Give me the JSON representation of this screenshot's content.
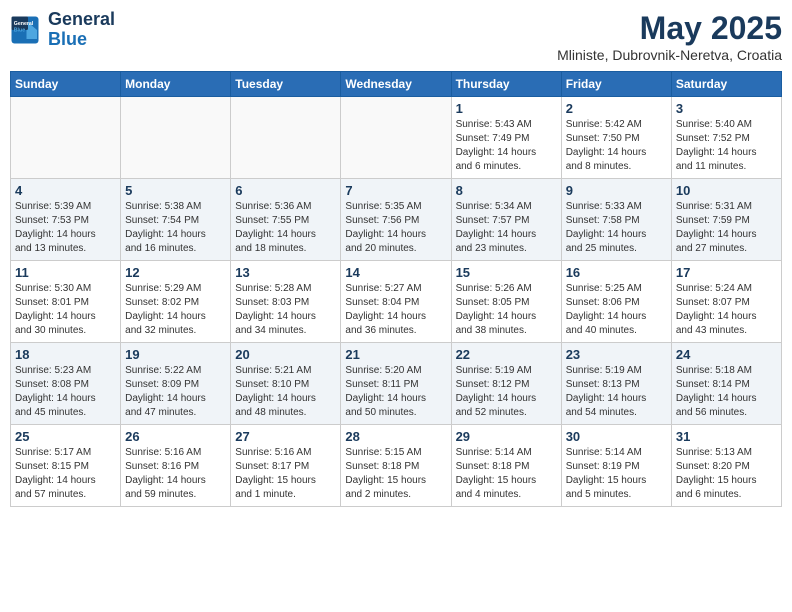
{
  "header": {
    "logo_line1": "General",
    "logo_line2": "Blue",
    "month": "May 2025",
    "location": "Mliniste, Dubrovnik-Neretva, Croatia"
  },
  "weekdays": [
    "Sunday",
    "Monday",
    "Tuesday",
    "Wednesday",
    "Thursday",
    "Friday",
    "Saturday"
  ],
  "weeks": [
    [
      {
        "day": "",
        "info": ""
      },
      {
        "day": "",
        "info": ""
      },
      {
        "day": "",
        "info": ""
      },
      {
        "day": "",
        "info": ""
      },
      {
        "day": "1",
        "info": "Sunrise: 5:43 AM\nSunset: 7:49 PM\nDaylight: 14 hours\nand 6 minutes."
      },
      {
        "day": "2",
        "info": "Sunrise: 5:42 AM\nSunset: 7:50 PM\nDaylight: 14 hours\nand 8 minutes."
      },
      {
        "day": "3",
        "info": "Sunrise: 5:40 AM\nSunset: 7:52 PM\nDaylight: 14 hours\nand 11 minutes."
      }
    ],
    [
      {
        "day": "4",
        "info": "Sunrise: 5:39 AM\nSunset: 7:53 PM\nDaylight: 14 hours\nand 13 minutes."
      },
      {
        "day": "5",
        "info": "Sunrise: 5:38 AM\nSunset: 7:54 PM\nDaylight: 14 hours\nand 16 minutes."
      },
      {
        "day": "6",
        "info": "Sunrise: 5:36 AM\nSunset: 7:55 PM\nDaylight: 14 hours\nand 18 minutes."
      },
      {
        "day": "7",
        "info": "Sunrise: 5:35 AM\nSunset: 7:56 PM\nDaylight: 14 hours\nand 20 minutes."
      },
      {
        "day": "8",
        "info": "Sunrise: 5:34 AM\nSunset: 7:57 PM\nDaylight: 14 hours\nand 23 minutes."
      },
      {
        "day": "9",
        "info": "Sunrise: 5:33 AM\nSunset: 7:58 PM\nDaylight: 14 hours\nand 25 minutes."
      },
      {
        "day": "10",
        "info": "Sunrise: 5:31 AM\nSunset: 7:59 PM\nDaylight: 14 hours\nand 27 minutes."
      }
    ],
    [
      {
        "day": "11",
        "info": "Sunrise: 5:30 AM\nSunset: 8:01 PM\nDaylight: 14 hours\nand 30 minutes."
      },
      {
        "day": "12",
        "info": "Sunrise: 5:29 AM\nSunset: 8:02 PM\nDaylight: 14 hours\nand 32 minutes."
      },
      {
        "day": "13",
        "info": "Sunrise: 5:28 AM\nSunset: 8:03 PM\nDaylight: 14 hours\nand 34 minutes."
      },
      {
        "day": "14",
        "info": "Sunrise: 5:27 AM\nSunset: 8:04 PM\nDaylight: 14 hours\nand 36 minutes."
      },
      {
        "day": "15",
        "info": "Sunrise: 5:26 AM\nSunset: 8:05 PM\nDaylight: 14 hours\nand 38 minutes."
      },
      {
        "day": "16",
        "info": "Sunrise: 5:25 AM\nSunset: 8:06 PM\nDaylight: 14 hours\nand 40 minutes."
      },
      {
        "day": "17",
        "info": "Sunrise: 5:24 AM\nSunset: 8:07 PM\nDaylight: 14 hours\nand 43 minutes."
      }
    ],
    [
      {
        "day": "18",
        "info": "Sunrise: 5:23 AM\nSunset: 8:08 PM\nDaylight: 14 hours\nand 45 minutes."
      },
      {
        "day": "19",
        "info": "Sunrise: 5:22 AM\nSunset: 8:09 PM\nDaylight: 14 hours\nand 47 minutes."
      },
      {
        "day": "20",
        "info": "Sunrise: 5:21 AM\nSunset: 8:10 PM\nDaylight: 14 hours\nand 48 minutes."
      },
      {
        "day": "21",
        "info": "Sunrise: 5:20 AM\nSunset: 8:11 PM\nDaylight: 14 hours\nand 50 minutes."
      },
      {
        "day": "22",
        "info": "Sunrise: 5:19 AM\nSunset: 8:12 PM\nDaylight: 14 hours\nand 52 minutes."
      },
      {
        "day": "23",
        "info": "Sunrise: 5:19 AM\nSunset: 8:13 PM\nDaylight: 14 hours\nand 54 minutes."
      },
      {
        "day": "24",
        "info": "Sunrise: 5:18 AM\nSunset: 8:14 PM\nDaylight: 14 hours\nand 56 minutes."
      }
    ],
    [
      {
        "day": "25",
        "info": "Sunrise: 5:17 AM\nSunset: 8:15 PM\nDaylight: 14 hours\nand 57 minutes."
      },
      {
        "day": "26",
        "info": "Sunrise: 5:16 AM\nSunset: 8:16 PM\nDaylight: 14 hours\nand 59 minutes."
      },
      {
        "day": "27",
        "info": "Sunrise: 5:16 AM\nSunset: 8:17 PM\nDaylight: 15 hours\nand 1 minute."
      },
      {
        "day": "28",
        "info": "Sunrise: 5:15 AM\nSunset: 8:18 PM\nDaylight: 15 hours\nand 2 minutes."
      },
      {
        "day": "29",
        "info": "Sunrise: 5:14 AM\nSunset: 8:18 PM\nDaylight: 15 hours\nand 4 minutes."
      },
      {
        "day": "30",
        "info": "Sunrise: 5:14 AM\nSunset: 8:19 PM\nDaylight: 15 hours\nand 5 minutes."
      },
      {
        "day": "31",
        "info": "Sunrise: 5:13 AM\nSunset: 8:20 PM\nDaylight: 15 hours\nand 6 minutes."
      }
    ]
  ]
}
